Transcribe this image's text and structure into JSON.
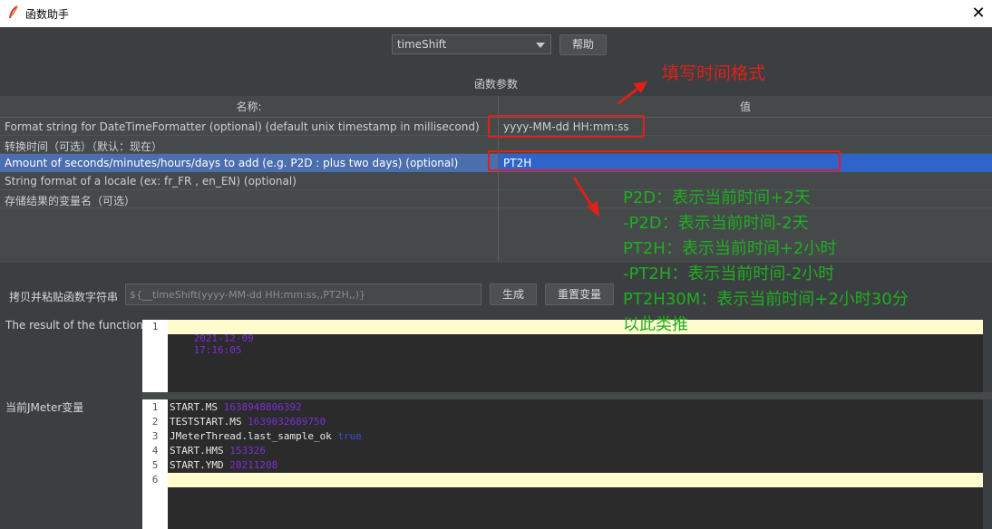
{
  "window": {
    "title": "函数助手",
    "close_icon": "close-icon"
  },
  "top": {
    "function_select": "timeShift",
    "help_label": "帮助"
  },
  "params": {
    "section_label": "函数参数",
    "col_name": "名称:",
    "col_value": "值",
    "rows": [
      {
        "name": "Format string for DateTimeFormatter (optional) (default unix timestamp in millisecond)",
        "value": "yyyy-MM-dd HH:mm:ss"
      },
      {
        "name": "转换时间（可选）（默认：现在）",
        "value": ""
      },
      {
        "name": "Amount of seconds/minutes/hours/days to add (e.g. P2D : plus two days) (optional)",
        "value": "PT2H"
      },
      {
        "name": "String format of a locale (ex: fr_FR , en_EN) (optional)",
        "value": ""
      },
      {
        "name": "存储结果的变量名（可选）",
        "value": ""
      }
    ]
  },
  "copy": {
    "label": "拷贝并粘贴函数字符串",
    "value": "${__timeShift(yyyy-MM-dd HH:mm:ss,,PT2H,,)}",
    "generate_label": "生成",
    "reset_label": "重置变量"
  },
  "result": {
    "label": "The result of the function is",
    "lines": [
      {
        "n": "1",
        "date": "2021-12-09",
        "time": "17:16:05"
      }
    ]
  },
  "vars": {
    "label": "当前JMeter变量",
    "lines": [
      {
        "n": "1",
        "key": "START.MS",
        "val": "1638948806392"
      },
      {
        "n": "2",
        "key": "TESTSTART.MS",
        "val": "1639032689750"
      },
      {
        "n": "3",
        "key": "JMeterThread.last_sample_ok",
        "val": "true"
      },
      {
        "n": "4",
        "key": "START.HMS",
        "val": "153326"
      },
      {
        "n": "5",
        "key": "START.YMD",
        "val": "20211208"
      },
      {
        "n": "6",
        "key": "",
        "val": ""
      }
    ]
  },
  "annotations": {
    "format_note": "填写时间格式",
    "examples": [
      "P2D：表示当前时间+2天",
      "-P2D：表示当前时间-2天",
      "PT2H：表示当前时间+2小时",
      "-PT2H：表示当前时间-2小时",
      "PT2H30M：表示当前时间+2小时30分",
      "以此类推"
    ]
  },
  "colors": {
    "background": "#3c3f41",
    "selection": "#4b6eaf",
    "annotation_red": "#e0201a",
    "annotation_green": "#1fae1f",
    "value_purple": "#7a2fd6"
  }
}
